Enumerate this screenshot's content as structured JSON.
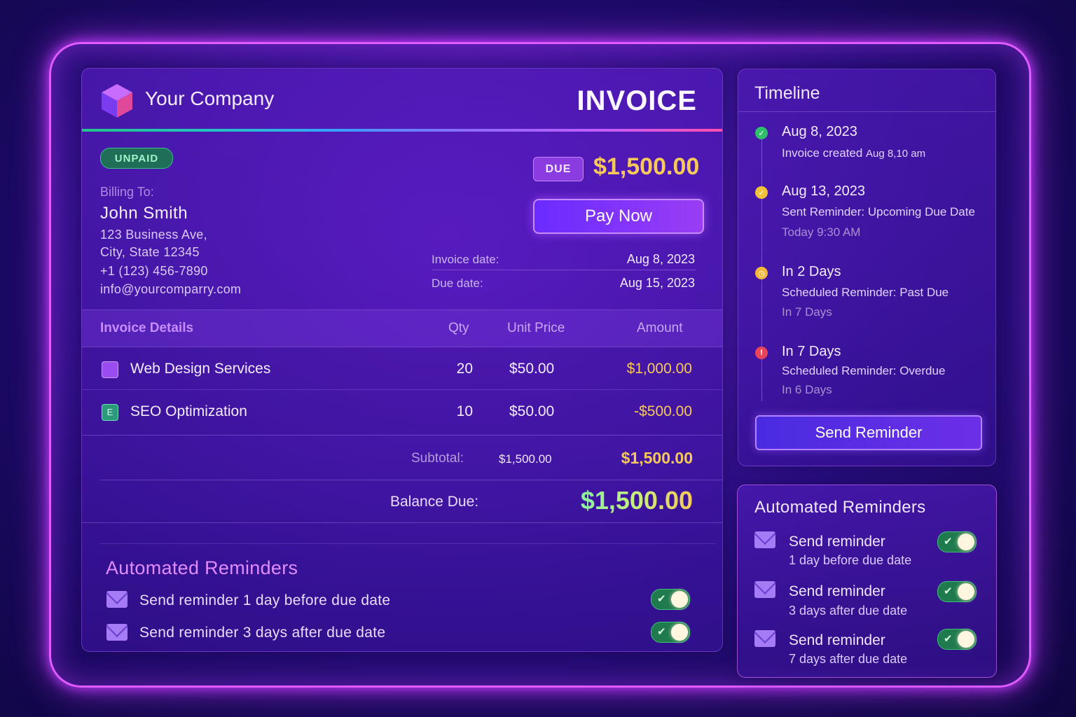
{
  "brand": {
    "company": "Your Company",
    "title": "INVOICE"
  },
  "status": {
    "badge": "UNPAID"
  },
  "billing": {
    "label": "Billing To:",
    "name": "John Smith",
    "address1": "123 Business Ave,",
    "address2": "City, State 12345",
    "phone": "+1 (123) 456-7890",
    "email": "info@yourcomparry.com"
  },
  "due": {
    "badge": "DUE",
    "amount": "$1,500.00",
    "pay_label": "Pay Now"
  },
  "dates": {
    "invoice_label": "Invoice date:",
    "invoice_value": "Aug 8, 2023",
    "due_label": "Due date:",
    "due_value": "Aug 15, 2023"
  },
  "table": {
    "headers": [
      "Invoice Details",
      "Qty",
      "Unit Price",
      "Amount"
    ],
    "rows": [
      {
        "name": "Web Design Services",
        "qty": "20",
        "price": "$50.00",
        "amount": "$1,000.00"
      },
      {
        "name": "SEO Optimization",
        "qty": "10",
        "price": "$50.00",
        "amount": "-$500.00"
      }
    ]
  },
  "totals": {
    "subtotal_label": "Subtotal:",
    "subtotal_value": "$1,500.00",
    "subtotal_amount": "$1,500.00",
    "balance_label": "Balance Due:",
    "balance_amount": "$1,500.00"
  },
  "reminders": {
    "title": "Automated Reminders",
    "items": [
      {
        "text": "Send reminder 1 day before due date",
        "enabled": true
      },
      {
        "text": "Send reminder 3 days after due date",
        "enabled": true
      }
    ]
  },
  "timeline": {
    "title": "Timeline",
    "events": [
      {
        "head": "Aug 8, 2023",
        "sub": "Invoice created",
        "sub_small": "Aug 8,10 am",
        "muted": "",
        "icon": "check-icon",
        "color": "#2fbf6a"
      },
      {
        "head": "Aug 13, 2023",
        "sub": "Sent Reminder: Upcoming Due Date",
        "sub_small": "",
        "muted": "Today 9:30 AM",
        "icon": "clock-icon",
        "color": "#f2c23a"
      },
      {
        "head": "In 2 Days",
        "sub": "Scheduled Reminder: Past Due",
        "sub_small": "",
        "muted": "In 7 Days",
        "icon": "clock-icon",
        "color": "#f2b83a"
      },
      {
        "head": "In 7 Days",
        "sub": "Scheduled Reminder: Overdue",
        "sub_small": "",
        "muted": "In 6 Days",
        "icon": "alert-icon",
        "color": "#e8455a"
      }
    ],
    "send_label": "Send Reminder"
  },
  "side_reminders": {
    "title": "Automated Reminders",
    "items": [
      {
        "line1": "Send reminder",
        "line2": "1 day before due date",
        "enabled": true
      },
      {
        "line1": "Send reminder",
        "line2": "3 days after due date",
        "enabled": true
      },
      {
        "line1": "Send reminder",
        "line2": "7 days after due date",
        "enabled": true
      }
    ]
  },
  "colors": {
    "accent": "#e05cff",
    "amount": "#f7c95a",
    "toggle_on": "#1f7a4e"
  }
}
